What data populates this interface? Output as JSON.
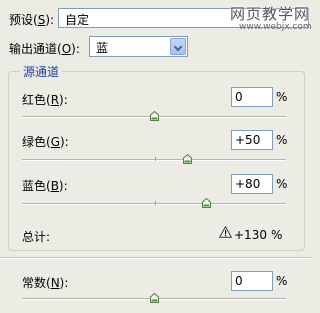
{
  "preset": {
    "label_pre": "预设(",
    "key": "S",
    "label_post": "):",
    "value": "自定"
  },
  "watermark": {
    "text": "网页教学网",
    "url": "www.webjx.com"
  },
  "output_channel": {
    "label_pre": "输出通道(",
    "key": "O",
    "label_post": "):",
    "value": "蓝"
  },
  "source_group": {
    "title": "源通道"
  },
  "channels": [
    {
      "label_pre": "红色(",
      "key": "R",
      "label_post": "):",
      "value": "0",
      "unit": "%",
      "percent": 0
    },
    {
      "label_pre": "绿色(",
      "key": "G",
      "label_post": "):",
      "value": "+50",
      "unit": "%",
      "percent": 50
    },
    {
      "label_pre": "蓝色(",
      "key": "B",
      "label_post": "):",
      "value": "+80",
      "unit": "%",
      "percent": 80
    }
  ],
  "total": {
    "label": "总计:",
    "value": "+130",
    "unit": "%",
    "icon": "warning-icon"
  },
  "constant": {
    "label_pre": "常数(",
    "key": "N",
    "label_post": "):",
    "value": "0",
    "unit": "%",
    "percent": 0
  }
}
